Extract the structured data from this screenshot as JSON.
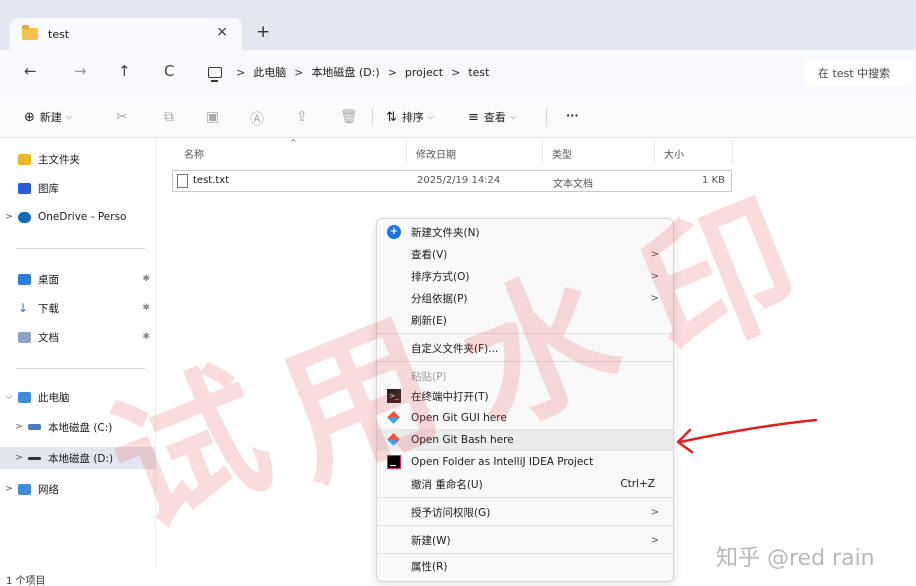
{
  "tab": {
    "title": "test",
    "close": "×",
    "add": "+"
  },
  "nav": {
    "back": "←",
    "forward": "→",
    "up": "↑",
    "refresh": "C",
    "breadcrumb": [
      "此电脑",
      "本地磁盘 (D:)",
      "project",
      "test"
    ],
    "separator": ">",
    "search_placeholder": "在 test 中搜索"
  },
  "toolbar": {
    "new": "新建",
    "new_chevron": "⌵",
    "sort": "排序",
    "view": "查看",
    "more": "···"
  },
  "sidebar": {
    "items": [
      {
        "label": "主文件夹",
        "icon": "home-icon"
      },
      {
        "label": "图库",
        "icon": "gallery-icon"
      },
      {
        "label": "OneDrive - Perso",
        "icon": "onedrive-icon"
      },
      {
        "label": "桌面",
        "icon": "desktop-icon"
      },
      {
        "label": "下载",
        "icon": "download-icon"
      },
      {
        "label": "文档",
        "icon": "documents-icon"
      },
      {
        "label": "此电脑",
        "icon": "this-pc-icon"
      },
      {
        "label": "本地磁盘 (C:)",
        "icon": "drive-c-icon"
      },
      {
        "label": "本地磁盘 (D:)",
        "icon": "drive-d-icon"
      },
      {
        "label": "网络",
        "icon": "network-icon"
      }
    ],
    "status": "1 个项目"
  },
  "files": {
    "columns": [
      "名称",
      "修改日期",
      "类型",
      "大小"
    ],
    "rows": [
      {
        "name": "test.txt",
        "modified": "2025/2/19 14:24",
        "type": "文本文档",
        "size": "1 KB"
      }
    ]
  },
  "context_menu": {
    "items": [
      {
        "label": "新建文件夹(N)"
      },
      {
        "label": "查看(V)"
      },
      {
        "label": "排序方式(O)"
      },
      {
        "label": "分组依据(P)"
      },
      {
        "label": "刷新(E)"
      },
      {
        "label": "自定义文件夹(F)..."
      },
      {
        "label": "粘贴(P)"
      },
      {
        "label": "在终端中打开(T)"
      },
      {
        "label": "Open Git GUI here"
      },
      {
        "label": "Open Git Bash here"
      },
      {
        "label": "Open Folder as IntelliJ IDEA Project"
      },
      {
        "label": "撤消 重命名(U)",
        "shortcut": "Ctrl+Z"
      },
      {
        "label": "授予访问权限(G)"
      },
      {
        "label": "新建(W)"
      },
      {
        "label": "属性(R)"
      }
    ],
    "submenu_arrow": ">"
  },
  "watermark": {
    "text": "试用水印",
    "signature": "知乎 @red rain"
  },
  "colors": {
    "annotation_arrow": "#e02020",
    "watermark": "#e63c3c"
  }
}
